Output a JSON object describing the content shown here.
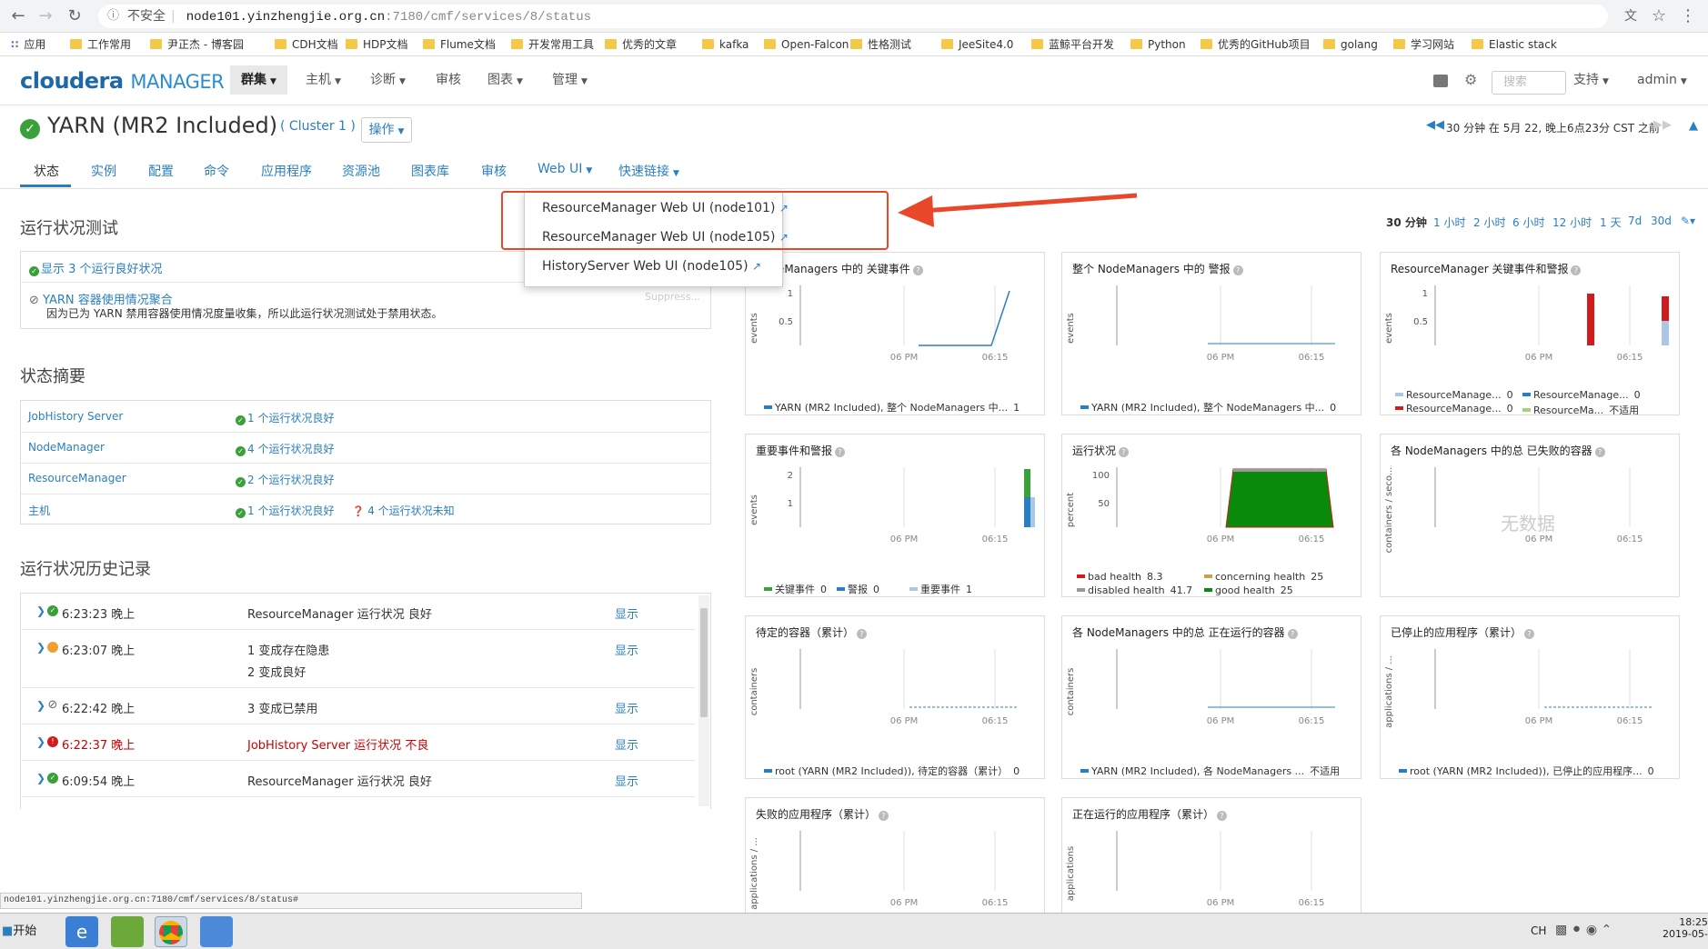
{
  "browser": {
    "insecure_label": "不安全",
    "url_host": "node101.yinzhengjie.org.cn",
    "url_path": ":7180/cmf/services/8/status",
    "status_url": "node101.yinzhengjie.org.cn:7180/cmf/services/8/status#"
  },
  "bookmarks": [
    "应用",
    "工作常用",
    "尹正杰 - 博客园",
    "CDH文档",
    "HDP文档",
    "Flume文档",
    "开发常用工具",
    "优秀的文章",
    "kafka",
    "Open-Falcon",
    "性格测试",
    "JeeSite4.0",
    "蓝鲸平台开发",
    "Python",
    "优秀的GitHub项目",
    "golang",
    "学习网站",
    "Elastic stack"
  ],
  "header": {
    "logo_brand": "cloudera",
    "logo_product": "MANAGER",
    "nav": [
      "群集",
      "主机",
      "诊断",
      "审核",
      "图表",
      "管理"
    ],
    "search_placeholder": "搜索",
    "support": "支持",
    "user": "admin"
  },
  "service": {
    "title": "YARN (MR2 Included)",
    "cluster": "( Cluster 1 )",
    "actions": "操作",
    "time_info": "30 分钟 在 5月 22, 晚上6点23分 CST 之前"
  },
  "tabs": [
    "状态",
    "实例",
    "配置",
    "命令",
    "应用程序",
    "资源池",
    "图表库",
    "审核",
    "Web UI",
    "快速链接"
  ],
  "webui_menu": [
    "ResourceManager Web UI (node101)",
    "ResourceManager Web UI (node105)",
    "HistoryServer Web UI (node105)"
  ],
  "health_tests": {
    "title": "运行状况测试",
    "good_link": "显示 3 个运行良好状况",
    "disabled_test": "YARN 容器使用情况聚合",
    "disabled_desc": "因为已为 YARN 禁用容器使用情况度量收集，所以此运行状况测试处于禁用状态。",
    "suppress": "Suppress..."
  },
  "status_summary": {
    "title": "状态摘要",
    "rows": [
      {
        "name": "JobHistory Server",
        "status": "1 个运行状况良好",
        "extra": ""
      },
      {
        "name": "NodeManager",
        "status": "4 个运行状况良好",
        "extra": ""
      },
      {
        "name": "ResourceManager",
        "status": "2 个运行状况良好",
        "extra": ""
      },
      {
        "name": "主机",
        "status": "1 个运行状况良好",
        "extra": "4 个运行状况未知"
      }
    ]
  },
  "health_history": {
    "title": "运行状况历史记录",
    "show_label": "显示",
    "rows": [
      {
        "time": "6:23:23 晚上",
        "msg": "ResourceManager 运行状况 良好",
        "msg2": "",
        "color": "#3aa03a",
        "kind": "ok"
      },
      {
        "time": "6:23:07 晚上",
        "msg": "1 变成存在隐患",
        "msg2": "2 变成良好",
        "color": "#f0a030",
        "kind": "warn"
      },
      {
        "time": "6:22:42 晚上",
        "msg": "3 变成已禁用",
        "msg2": "",
        "color": "#888888",
        "kind": "disabled"
      },
      {
        "time": "6:22:37 晚上",
        "msg": "JobHistory Server 运行状况 不良",
        "msg2": "",
        "color": "#d01c1c",
        "kind": "bad"
      },
      {
        "time": "6:09:54 晚上",
        "msg": "ResourceManager 运行状况 良好",
        "msg2": "",
        "color": "#3aa03a",
        "kind": "ok"
      }
    ]
  },
  "time_ranges": [
    "30 分钟",
    "1 小时",
    "2 小时",
    "6 小时",
    "12 小时",
    "1 天",
    "7d",
    "30d"
  ],
  "chart_x_ticks": [
    "06 PM",
    "06:15"
  ],
  "chart_data": [
    {
      "type": "line",
      "title": "NodeManagers 中的 关键事件",
      "ylabel": "events",
      "yticks": [
        "1",
        "0.5"
      ],
      "ylim": [
        0,
        1
      ],
      "series": [
        {
          "name": "YARN (MR2 Included), 整个 NodeManagers 中...",
          "last": "1",
          "values": [
            0,
            0,
            0,
            0,
            0,
            1
          ]
        }
      ]
    },
    {
      "type": "line",
      "title": "整个 NodeManagers 中的 警报",
      "ylabel": "events",
      "yticks": [],
      "ylim": [
        0,
        1
      ],
      "series": [
        {
          "name": "YARN (MR2 Included), 整个 NodeManagers 中...",
          "last": "0",
          "values": [
            0,
            0,
            0,
            0,
            0,
            0
          ]
        }
      ]
    },
    {
      "type": "bar",
      "title": "ResourceManager 关键事件和警报",
      "ylabel": "events",
      "yticks": [
        "1",
        "0.5"
      ],
      "ylim": [
        0,
        1
      ],
      "series": [
        {
          "name": "ResourceManage...",
          "last": "0"
        },
        {
          "name": "ResourceManage...",
          "last": "0"
        },
        {
          "name": "ResourceManage...",
          "last": "0"
        },
        {
          "name": "ResourceMa...",
          "last": "不适用"
        }
      ]
    },
    {
      "type": "bar",
      "title": "重要事件和警报",
      "ylabel": "events",
      "yticks": [
        "2",
        "1"
      ],
      "ylim": [
        0,
        2
      ],
      "series": [
        {
          "name": "关键事件",
          "last": "0"
        },
        {
          "name": "警报",
          "last": "0"
        },
        {
          "name": "重要事件",
          "last": "1"
        }
      ]
    },
    {
      "type": "area",
      "title": "运行状况",
      "ylabel": "percent",
      "yticks": [
        "100",
        "50"
      ],
      "ylim": [
        0,
        100
      ],
      "series": [
        {
          "name": "bad health",
          "last": "8.3"
        },
        {
          "name": "concerning health",
          "last": "25"
        },
        {
          "name": "disabled health",
          "last": "41.7"
        },
        {
          "name": "good health",
          "last": "25"
        }
      ]
    },
    {
      "type": "line",
      "title": "各 NodeManagers 中的总 已失败的容器",
      "ylabel": "containers / seco...",
      "yticks": [],
      "no_data": "无数据",
      "series": []
    },
    {
      "type": "line",
      "title": "待定的容器（累计）",
      "ylabel": "containers",
      "yticks": [],
      "series": [
        {
          "name": "root (YARN (MR2 Included)), 待定的容器（累计）",
          "last": "0"
        }
      ]
    },
    {
      "type": "line",
      "title": "各 NodeManagers 中的总 正在运行的容器",
      "ylabel": "containers",
      "yticks": [],
      "series": [
        {
          "name": "YARN (MR2 Included), 各 NodeManagers ...",
          "last": "不适用"
        }
      ]
    },
    {
      "type": "line",
      "title": "已停止的应用程序（累计）",
      "ylabel": "applications / ...",
      "yticks": [],
      "series": [
        {
          "name": "root (YARN (MR2 Included)), 已停止的应用程序...",
          "last": "0"
        }
      ]
    },
    {
      "type": "line",
      "title": "失败的应用程序（累计）",
      "ylabel": "applications / ...",
      "yticks": [],
      "series": []
    },
    {
      "type": "line",
      "title": "正在运行的应用程序（累计）",
      "ylabel": "applications",
      "yticks": [],
      "series": []
    }
  ],
  "taskbar": {
    "start": "开始",
    "lang": "CH",
    "time": "18:25",
    "date": "2019-05-"
  },
  "colors": {
    "accent": "#2a7fc1",
    "good": "#3aa03a",
    "bad": "#d01c1c",
    "warn": "#f0a030",
    "annotation": "#e8472a"
  }
}
